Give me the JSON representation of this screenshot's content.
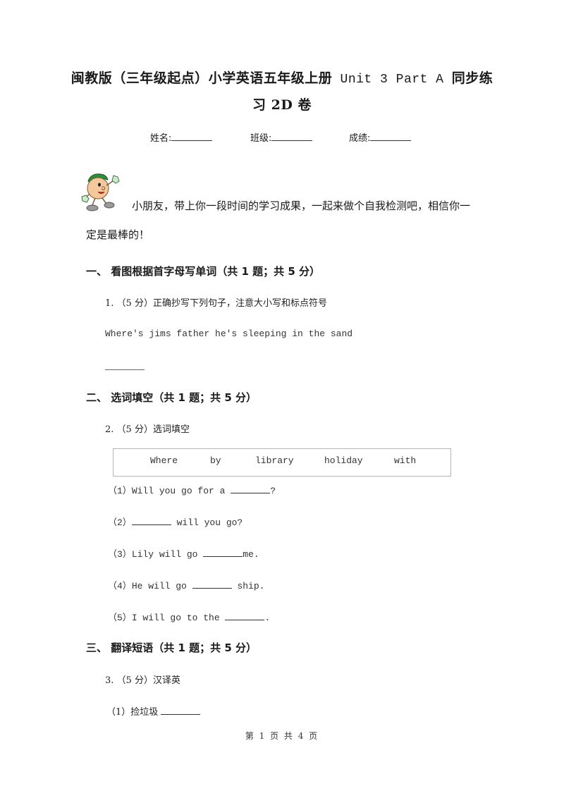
{
  "document": {
    "title_line1_cn": "闽教版（三年级起点）小学英语五年级上册",
    "title_line1_en": "Unit 3 Part A",
    "title_line1_cn2": "同步练",
    "title_line2": "习 2D 卷"
  },
  "student_info": {
    "name_label": "姓名:",
    "class_label": "班级:",
    "score_label": "成绩:"
  },
  "intro": {
    "line1": "小朋友，带上你一段时间的学习成果，一起来做个自我检测吧，相信你一",
    "line2": "定是最棒的！"
  },
  "sections": [
    {
      "heading": "一、  看图根据首字母写单词（共 1 题；共 5 分）",
      "question": {
        "number": "1.",
        "points": "（5 分）",
        "prompt": "正确抄写下列句子，注意大小写和标点符号",
        "sentence": "Where's jims father he's sleeping in the sand"
      }
    },
    {
      "heading": "二、  选词填空（共 1 题；共 5 分）",
      "question": {
        "number": "2.",
        "points": "（5 分）",
        "prompt": "选词填空",
        "word_bank": [
          "Where",
          "by",
          "library",
          "holiday",
          "with"
        ],
        "items": [
          {
            "label": "（1）",
            "before": "Will you go for a ",
            "after": "?"
          },
          {
            "label": "（2）",
            "before": "",
            "after": " will you go?"
          },
          {
            "label": "（3）",
            "before": "Lily will go ",
            "after": "me."
          },
          {
            "label": "（4）",
            "before": "He will go ",
            "after": " ship."
          },
          {
            "label": "（5）",
            "before": "I will go to the ",
            "after": "."
          }
        ]
      }
    },
    {
      "heading": "三、  翻译短语（共 1 题；共 5 分）",
      "question": {
        "number": "3.",
        "points": "（5 分）",
        "prompt": "汉译英",
        "items": [
          {
            "label": "（1）",
            "text": "捡垃圾 "
          }
        ]
      }
    }
  ],
  "footer": {
    "page_text": "第 1 页 共 4 页"
  }
}
